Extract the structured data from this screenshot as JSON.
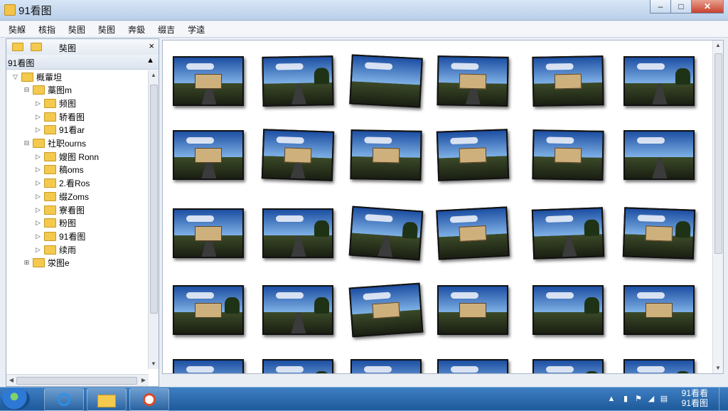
{
  "window": {
    "title": "91看图"
  },
  "window_controls": {
    "minimize": "–",
    "maximize": "□",
    "close": "✕"
  },
  "menu": [
    "奘緥",
    "核指",
    "奘图",
    "奘图",
    "奔鈒",
    "缀吉",
    "学逵"
  ],
  "sidebar": {
    "toolbar_label": "奘图",
    "close": "×",
    "header_label": "91看图",
    "collapse": "▲",
    "tree": [
      {
        "label": "概輩坦",
        "level": 0,
        "expander": "▽"
      },
      {
        "label": "藁图m",
        "level": 1,
        "expander": "⊟"
      },
      {
        "label": "频图",
        "level": 2,
        "expander": "▷"
      },
      {
        "label": "轿看图",
        "level": 2,
        "expander": "▷"
      },
      {
        "label": "91看ar",
        "level": 2,
        "expander": "▷"
      },
      {
        "label": "社职ourns",
        "level": 1,
        "expander": "⊟"
      },
      {
        "label": "嫂图 Ronn",
        "level": 2,
        "expander": "▷"
      },
      {
        "label": "稿oms",
        "level": 2,
        "expander": "▷"
      },
      {
        "label": "2.看Ros",
        "level": 2,
        "expander": "▷"
      },
      {
        "label": "缀Zoms",
        "level": 2,
        "expander": "▷"
      },
      {
        "label": "寮看图",
        "level": 2,
        "expander": "▷"
      },
      {
        "label": "粉图",
        "level": 2,
        "expander": "▷"
      },
      {
        "label": "91看图",
        "level": 2,
        "expander": "▷"
      },
      {
        "label": "续雨",
        "level": 2,
        "expander": "▷"
      },
      {
        "label": "泶图e",
        "level": 1,
        "expander": "⊞"
      }
    ]
  },
  "gallery": {
    "thumbnails": [
      {
        "scene": "house-road"
      },
      {
        "scene": "road-trees"
      },
      {
        "scene": "river-sun"
      },
      {
        "scene": "house-road"
      },
      {
        "scene": "house"
      },
      {
        "scene": "road-trees"
      },
      {
        "scene": "house-road"
      },
      {
        "scene": "house-road"
      },
      {
        "scene": "house"
      },
      {
        "scene": "house-lake"
      },
      {
        "scene": "house"
      },
      {
        "scene": "road"
      },
      {
        "scene": "building-road"
      },
      {
        "scene": "road-field"
      },
      {
        "scene": "trees-path"
      },
      {
        "scene": "house-lake"
      },
      {
        "scene": "road-trees"
      },
      {
        "scene": "house-canal"
      },
      {
        "scene": "house-canal"
      },
      {
        "scene": "road-trees"
      },
      {
        "scene": "house-lake"
      },
      {
        "scene": "house"
      },
      {
        "scene": "lake-trees"
      },
      {
        "scene": "house"
      },
      {
        "scene": "sky"
      },
      {
        "scene": "trees"
      },
      {
        "scene": "sky"
      },
      {
        "scene": "sky"
      },
      {
        "scene": "trees"
      },
      {
        "scene": "trees"
      }
    ]
  },
  "taskbar": {
    "items": [
      "start-orb",
      "internet-explorer",
      "file-explorer",
      "91-viewer"
    ],
    "clock": {
      "line1": "91看看",
      "line2": "91看图"
    }
  }
}
